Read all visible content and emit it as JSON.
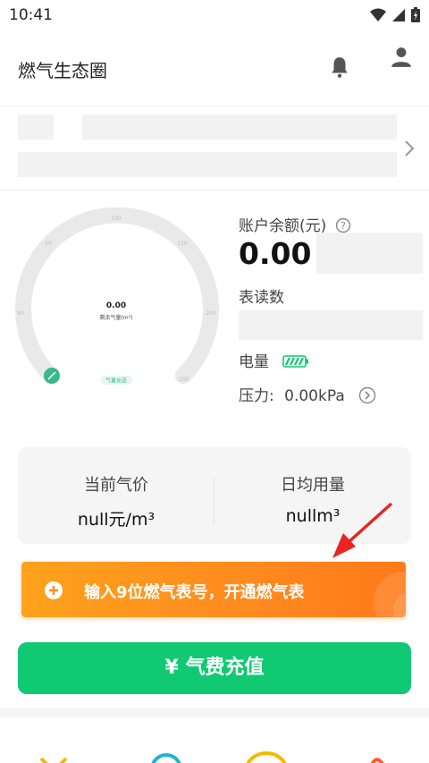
{
  "status": {
    "time": "10:41"
  },
  "header": {
    "title": "燃气生态圈"
  },
  "gauge": {
    "value": "0.00",
    "label": "剩余气量(m³)",
    "badge": "气量充足",
    "ticks": [
      "0",
      "50",
      "90",
      "100",
      "150",
      "200",
      "250"
    ],
    "level": 0.0
  },
  "account": {
    "balance_label": "账户余额(元)",
    "balance_value": "0.00",
    "meter_label": "表读数",
    "battery_label": "电量",
    "pressure_label": "压力:",
    "pressure_value": "0.00kPa"
  },
  "stats": {
    "price_label": "当前气价",
    "price_value": "null元/m³",
    "daily_label": "日均用量",
    "daily_value": "nullm³"
  },
  "banner": {
    "text": "输入9位燃气表号，开通燃气表"
  },
  "recharge": {
    "label": "¥ 气费充值"
  },
  "colors": {
    "accent": "#10c972",
    "banner": "#ff8a1f"
  }
}
